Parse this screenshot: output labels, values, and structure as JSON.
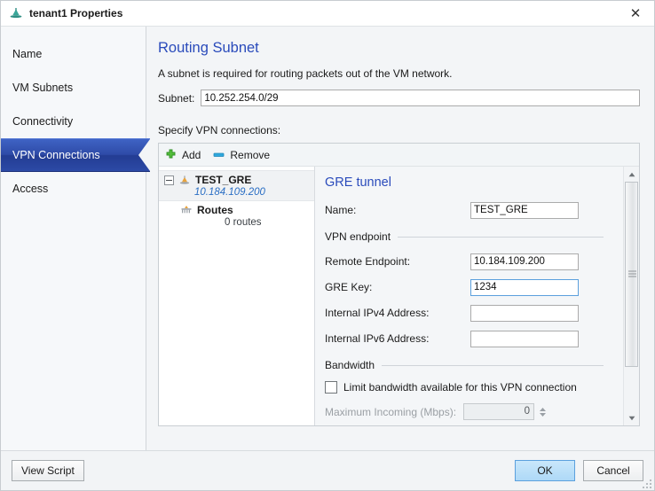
{
  "window": {
    "title": "tenant1 Properties",
    "title_icon": "tenant-network-icon",
    "close_label": "✕"
  },
  "sidebar": {
    "items": [
      {
        "label": "Name",
        "selected": false
      },
      {
        "label": "VM Subnets",
        "selected": false
      },
      {
        "label": "Connectivity",
        "selected": false
      },
      {
        "label": "VPN Connections",
        "selected": true
      },
      {
        "label": "Access",
        "selected": false
      }
    ],
    "selected_bg": "#2e4ba8",
    "selected_fg": "#ffffff"
  },
  "content": {
    "page_title": "Routing Subnet",
    "description": "A subnet is required for routing packets out of the VM network.",
    "subnet_label": "Subnet:",
    "subnet_value": "10.252.254.0/29",
    "subnet_placeholder": "",
    "vpn_section_label": "Specify VPN connections:"
  },
  "toolbar": {
    "add_label": "Add",
    "add_icon": "plus-icon",
    "remove_label": "Remove",
    "remove_icon": "minus-icon"
  },
  "tree": {
    "root": {
      "label": "TEST_GRE",
      "sub": "10.184.109.200",
      "icon": "vpn-connection-icon",
      "expander": "collapse-box",
      "selected": true
    },
    "child": {
      "label": "Routes",
      "sub": "0 routes",
      "icon": "routes-icon"
    }
  },
  "details": {
    "title": "GRE tunnel",
    "fields": [
      {
        "label": "Name:",
        "value": "TEST_GRE",
        "focused": false,
        "disabled": false
      },
      {
        "label": "Remote Endpoint:",
        "value": "10.184.109.200",
        "focused": false,
        "disabled": false
      },
      {
        "label": "GRE Key:",
        "value": "1234",
        "focused": true,
        "disabled": false
      },
      {
        "label": "Internal IPv4 Address:",
        "value": "",
        "focused": false,
        "disabled": false
      },
      {
        "label": "Internal IPv6 Address:",
        "value": "",
        "focused": false,
        "disabled": false
      }
    ],
    "group_vpn_endpoint": "VPN endpoint",
    "group_bandwidth": "Bandwidth",
    "limit_checkbox_label": "Limit bandwidth available for this VPN connection",
    "limit_checkbox_checked": false,
    "max_incoming_label": "Maximum Incoming (Mbps):",
    "max_incoming_value": "0",
    "max_incoming_disabled": true,
    "accent": "#2a4bbb",
    "focus_border": "#5ba0dd"
  },
  "scrollbar": {
    "up_arrow": "▲",
    "down_arrow": "▼"
  },
  "footer": {
    "view_script_label": "View Script",
    "ok_label": "OK",
    "cancel_label": "Cancel"
  }
}
